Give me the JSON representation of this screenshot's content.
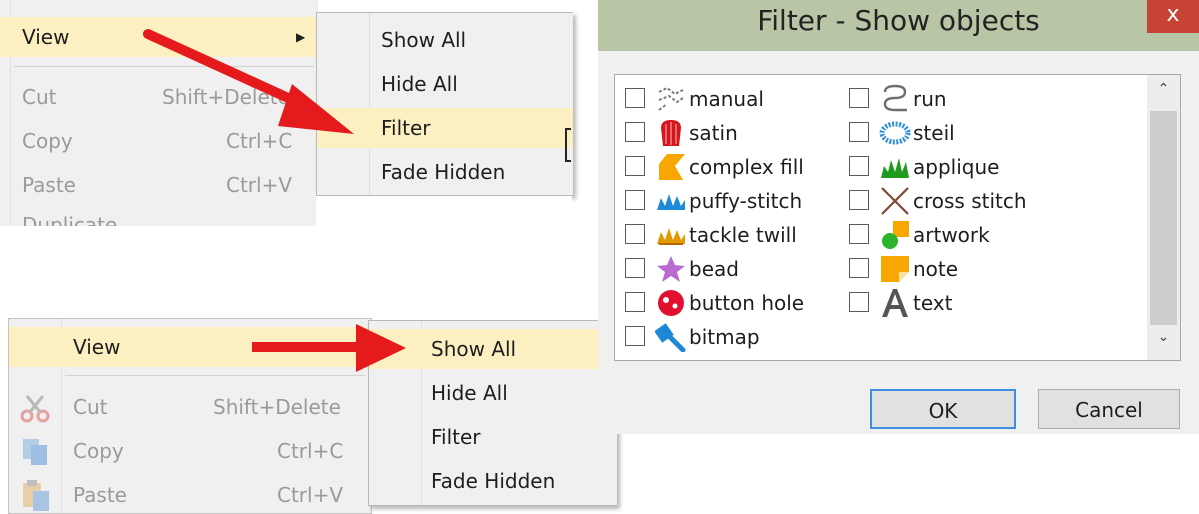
{
  "top_menu": {
    "items": [
      {
        "label": "View",
        "shortcut": "",
        "highlighted": true,
        "has_submenu": true
      },
      {
        "label": "Cut",
        "shortcut": "Shift+Delete",
        "disabled": true
      },
      {
        "label": "Copy",
        "shortcut": "Ctrl+C",
        "disabled": true
      },
      {
        "label": "Paste",
        "shortcut": "Ctrl+V",
        "disabled": true
      },
      {
        "label": "Duplicate",
        "shortcut": "",
        "disabled": true
      }
    ],
    "submenu": [
      {
        "label": "Show All"
      },
      {
        "label": "Hide All"
      },
      {
        "label": "Filter",
        "highlighted": true
      },
      {
        "label": "Fade Hidden"
      }
    ],
    "arrow_color": "#e41a1c"
  },
  "bottom_menu": {
    "items": [
      {
        "label": "View",
        "icon": "",
        "highlighted": true
      },
      {
        "label": "Cut",
        "shortcut": "Shift+Delete",
        "icon": "scissors-icon",
        "disabled": true
      },
      {
        "label": "Copy",
        "shortcut": "Ctrl+C",
        "icon": "copy-icon",
        "disabled": true
      },
      {
        "label": "Paste",
        "shortcut": "Ctrl+V",
        "icon": "paste-icon",
        "disabled": true
      }
    ],
    "submenu": [
      {
        "label": "Show All",
        "highlighted": true
      },
      {
        "label": "Hide All"
      },
      {
        "label": "Filter"
      },
      {
        "label": "Fade Hidden"
      }
    ]
  },
  "dialog": {
    "title": "Filter - Show objects",
    "close_glyph": "x",
    "left_column": [
      {
        "label": "manual",
        "icon": "manual-stitch-icon",
        "checked": false
      },
      {
        "label": "satin",
        "icon": "satin-icon",
        "checked": false
      },
      {
        "label": "complex fill",
        "icon": "complex-fill-icon",
        "checked": false
      },
      {
        "label": "puffy-stitch",
        "icon": "puffy-stitch-icon",
        "checked": false
      },
      {
        "label": "tackle twill",
        "icon": "tackle-twill-icon",
        "checked": false
      },
      {
        "label": "bead",
        "icon": "bead-icon",
        "checked": false
      },
      {
        "label": "button hole",
        "icon": "button-hole-icon",
        "checked": false
      },
      {
        "label": "bitmap",
        "icon": "bitmap-icon",
        "checked": false
      }
    ],
    "right_column": [
      {
        "label": "run",
        "icon": "run-stitch-icon",
        "checked": false
      },
      {
        "label": "steil",
        "icon": "steil-icon",
        "checked": false
      },
      {
        "label": "applique",
        "icon": "applique-icon",
        "checked": false
      },
      {
        "label": "cross stitch",
        "icon": "cross-stitch-icon",
        "checked": false
      },
      {
        "label": "artwork",
        "icon": "artwork-icon",
        "checked": false
      },
      {
        "label": "note",
        "icon": "note-icon",
        "checked": false
      },
      {
        "label": "text",
        "icon": "text-icon",
        "checked": false
      }
    ],
    "ok_label": "OK",
    "cancel_label": "Cancel",
    "title_bar_color": "#b8c6a6",
    "close_color": "#c74434",
    "ok_border_color": "#3d8ee0"
  }
}
